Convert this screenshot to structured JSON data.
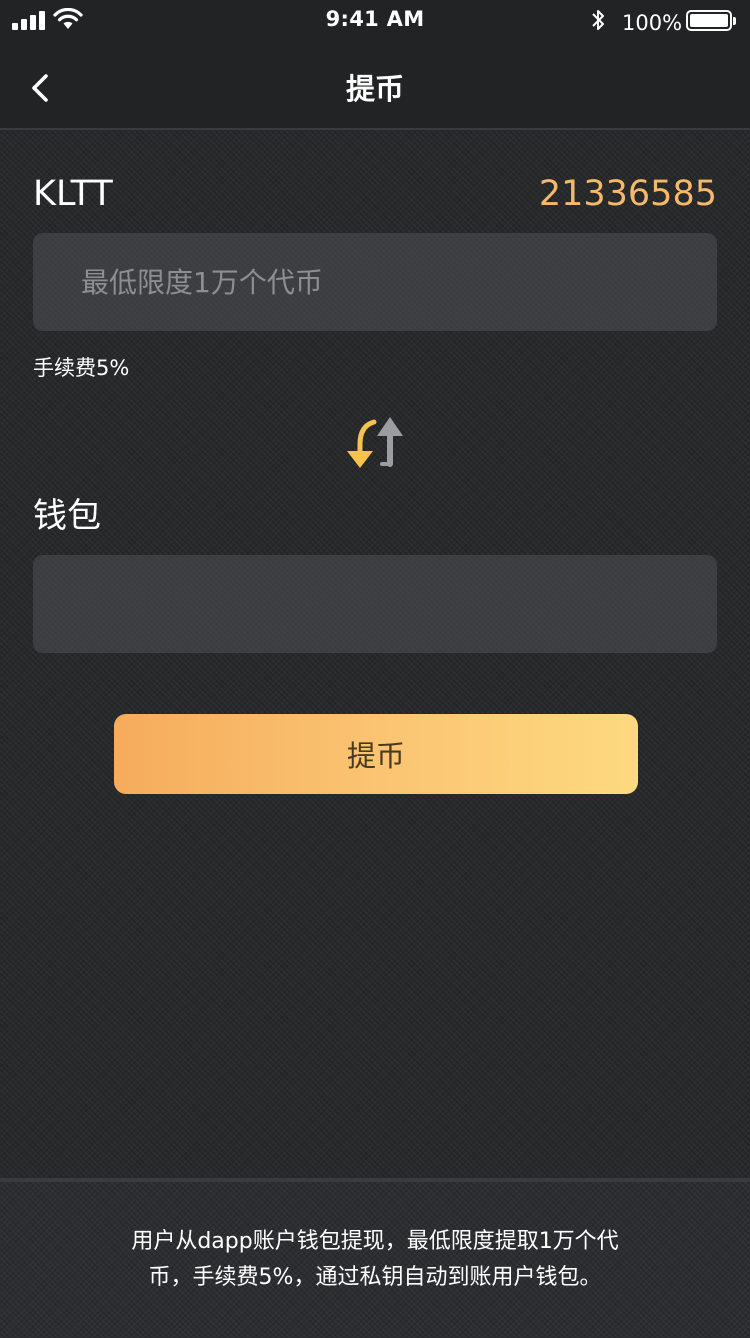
{
  "status_bar": {
    "time": "9:41 AM",
    "battery": "100%",
    "icons": [
      "signal-icon",
      "wifi-icon",
      "bluetooth-icon",
      "battery-icon"
    ]
  },
  "nav": {
    "title": "提币",
    "back_icon": "chevron-left-icon"
  },
  "token": {
    "name": "KLTT",
    "balance": "21336585"
  },
  "amount_input": {
    "value": "",
    "placeholder": "最低限度1万个代币"
  },
  "fee": "手续费5%",
  "swap_icon": "swap-arrows-icon",
  "wallet": {
    "label": "钱包",
    "value": "",
    "placeholder": ""
  },
  "submit_label": "提币",
  "footer_note": "用户从dapp账户钱包提现，最低限度提取1万个代币，手续费5%，通过私钥自动到账用户钱包。",
  "colors": {
    "accent": "#f6b96b",
    "button_gradient_start": "#f5ac5c",
    "button_gradient_end": "#fdd97f",
    "background": "#252628"
  }
}
